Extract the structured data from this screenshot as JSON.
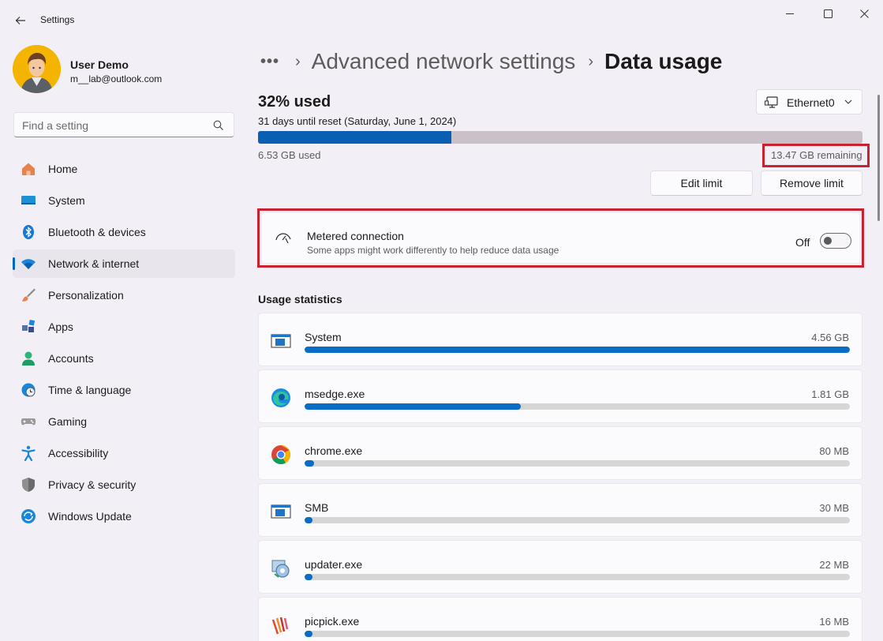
{
  "window": {
    "title": "Settings"
  },
  "profile": {
    "name": "User Demo",
    "email": "m__lab@outlook.com"
  },
  "search": {
    "placeholder": "Find a setting"
  },
  "sidebar": {
    "items": [
      {
        "label": "Home",
        "icon": "home-icon",
        "active": false
      },
      {
        "label": "System",
        "icon": "system-icon",
        "active": false
      },
      {
        "label": "Bluetooth & devices",
        "icon": "bluetooth-icon",
        "active": false
      },
      {
        "label": "Network & internet",
        "icon": "wifi-icon",
        "active": true
      },
      {
        "label": "Personalization",
        "icon": "brush-icon",
        "active": false
      },
      {
        "label": "Apps",
        "icon": "apps-icon",
        "active": false
      },
      {
        "label": "Accounts",
        "icon": "person-icon",
        "active": false
      },
      {
        "label": "Time & language",
        "icon": "clock-globe-icon",
        "active": false
      },
      {
        "label": "Gaming",
        "icon": "gamepad-icon",
        "active": false
      },
      {
        "label": "Accessibility",
        "icon": "accessibility-icon",
        "active": false
      },
      {
        "label": "Privacy & security",
        "icon": "shield-icon",
        "active": false
      },
      {
        "label": "Windows Update",
        "icon": "update-icon",
        "active": false
      }
    ]
  },
  "breadcrumb": {
    "more": "•••",
    "parent": "Advanced network settings",
    "current": "Data usage"
  },
  "usage": {
    "percent_label": "32% used",
    "reset_text": "31 days until reset (Saturday, June 1, 2024)",
    "used_fraction": 0.32,
    "used_text": "6.53 GB used",
    "remaining_text": "13.47 GB remaining"
  },
  "adapter": {
    "selected": "Ethernet0"
  },
  "buttons": {
    "edit_limit": "Edit limit",
    "remove_limit": "Remove limit"
  },
  "metered": {
    "title": "Metered connection",
    "subtitle": "Some apps might work differently to help reduce data usage",
    "state": "Off",
    "enabled": false
  },
  "stats": {
    "heading": "Usage statistics",
    "apps": [
      {
        "name": "System",
        "size": "4.56 GB",
        "fraction": 1.0,
        "icon": "system-app-icon"
      },
      {
        "name": "msedge.exe",
        "size": "1.81 GB",
        "fraction": 0.397,
        "icon": "edge-icon"
      },
      {
        "name": "chrome.exe",
        "size": "80 MB",
        "fraction": 0.017,
        "icon": "chrome-icon"
      },
      {
        "name": "SMB",
        "size": "30 MB",
        "fraction": 0.006,
        "icon": "system-app-icon"
      },
      {
        "name": "updater.exe",
        "size": "22 MB",
        "fraction": 0.005,
        "icon": "updater-icon"
      },
      {
        "name": "picpick.exe",
        "size": "16 MB",
        "fraction": 0.004,
        "icon": "picpick-icon"
      }
    ]
  },
  "colors": {
    "accent": "#0b5fb2",
    "highlight_border": "#c8212f",
    "background": "#f3eff6"
  }
}
